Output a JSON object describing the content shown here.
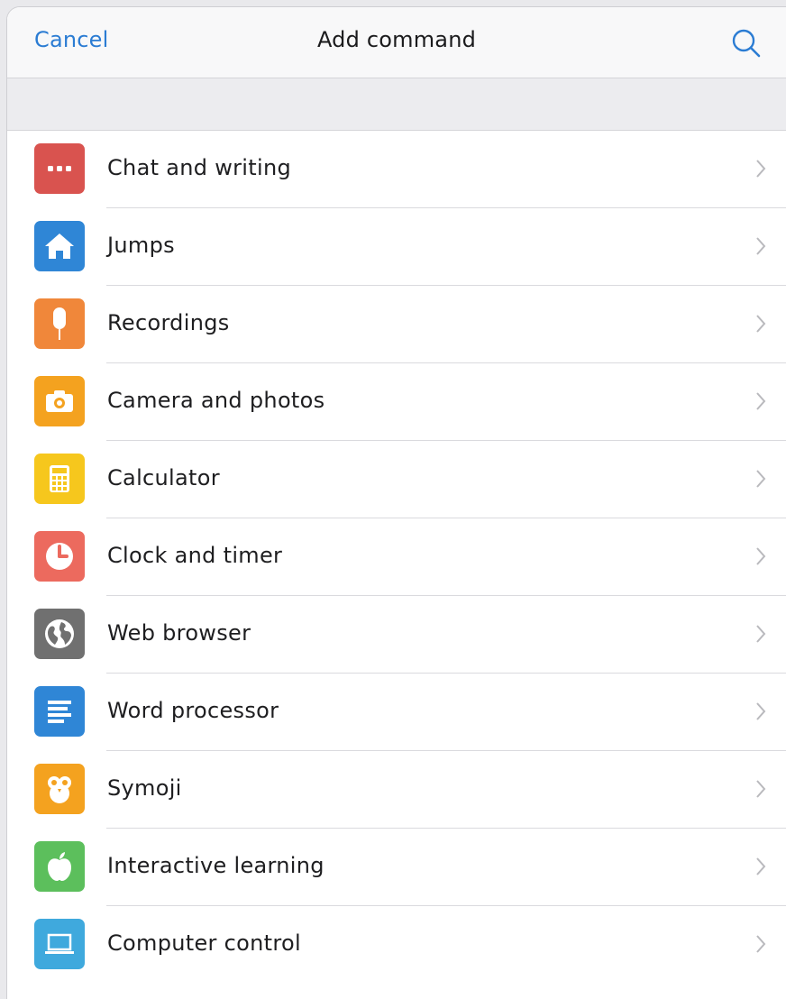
{
  "nav": {
    "cancel_label": "Cancel",
    "title": "Add command",
    "search_icon": "search-icon",
    "accent_color": "#2b7cd3"
  },
  "commands": [
    {
      "label": "Chat and writing",
      "icon": "chat-dots-icon",
      "color": "#d9534f"
    },
    {
      "label": "Jumps",
      "icon": "home-icon",
      "color": "#2f86d6"
    },
    {
      "label": "Recordings",
      "icon": "microphone-icon",
      "color": "#f0873a"
    },
    {
      "label": "Camera and photos",
      "icon": "camera-icon",
      "color": "#f4a21f"
    },
    {
      "label": "Calculator",
      "icon": "calculator-icon",
      "color": "#f6c71d"
    },
    {
      "label": "Clock and timer",
      "icon": "clock-icon",
      "color": "#ec6a5e"
    },
    {
      "label": "Web browser",
      "icon": "globe-icon",
      "color": "#707070"
    },
    {
      "label": "Word processor",
      "icon": "document-icon",
      "color": "#2f86d6"
    },
    {
      "label": "Symoji",
      "icon": "symoji-owl-icon",
      "color": "#f4a21f"
    },
    {
      "label": "Interactive learning",
      "icon": "apple-icon",
      "color": "#5cbf5c"
    },
    {
      "label": "Computer control",
      "icon": "laptop-icon",
      "color": "#3fa9dd"
    }
  ]
}
